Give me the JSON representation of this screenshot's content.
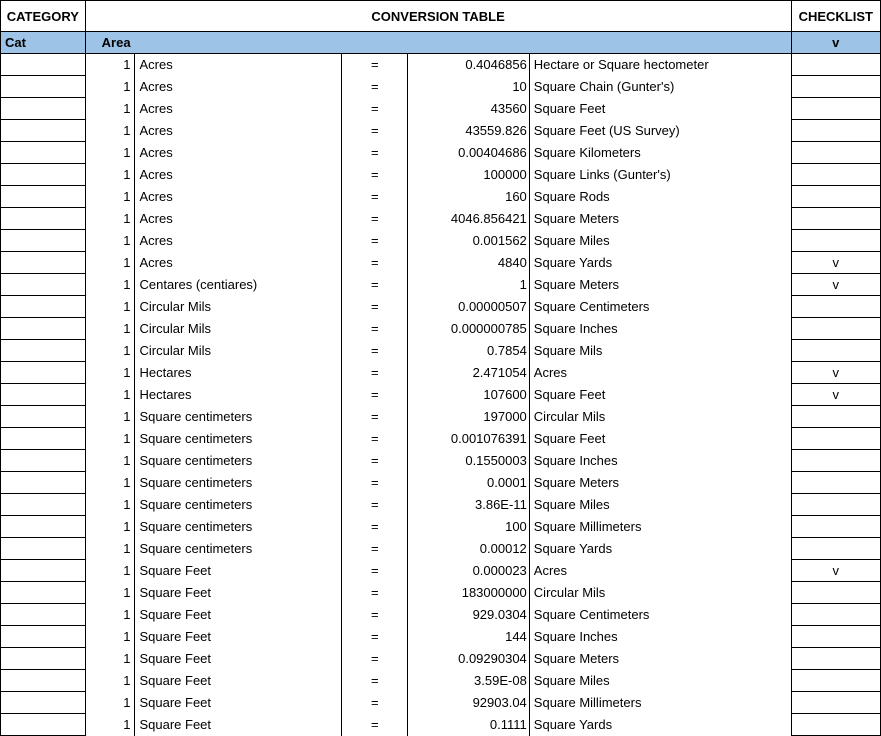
{
  "titles": {
    "category": "CATEGORY",
    "main": "CONVERSION TABLE",
    "checklist": "CHECKLIST"
  },
  "headers": {
    "cat": "Cat",
    "area": "Area",
    "chk": "v"
  },
  "rows": [
    {
      "qty": "1",
      "from": "Acres",
      "eq": "=",
      "val": "0.4046856",
      "to": "Hectare or Square hectometer",
      "chk": ""
    },
    {
      "qty": "1",
      "from": "Acres",
      "eq": "=",
      "val": "10",
      "to": "Square Chain (Gunter's)",
      "chk": ""
    },
    {
      "qty": "1",
      "from": "Acres",
      "eq": "=",
      "val": "43560",
      "to": "Square Feet",
      "chk": ""
    },
    {
      "qty": "1",
      "from": "Acres",
      "eq": "=",
      "val": "43559.826",
      "to": "Square Feet (US Survey)",
      "chk": ""
    },
    {
      "qty": "1",
      "from": "Acres",
      "eq": "=",
      "val": "0.00404686",
      "to": "Square Kilometers",
      "chk": ""
    },
    {
      "qty": "1",
      "from": "Acres",
      "eq": "=",
      "val": "100000",
      "to": "Square Links (Gunter's)",
      "chk": ""
    },
    {
      "qty": "1",
      "from": "Acres",
      "eq": "=",
      "val": "160",
      "to": "Square Rods",
      "chk": ""
    },
    {
      "qty": "1",
      "from": "Acres",
      "eq": "=",
      "val": "4046.856421",
      "to": "Square Meters",
      "chk": ""
    },
    {
      "qty": "1",
      "from": "Acres",
      "eq": "=",
      "val": "0.001562",
      "to": "Square Miles",
      "chk": ""
    },
    {
      "qty": "1",
      "from": "Acres",
      "eq": "=",
      "val": "4840",
      "to": "Square Yards",
      "chk": "v"
    },
    {
      "qty": "1",
      "from": "Centares (centiares)",
      "eq": "=",
      "val": "1",
      "to": "Square Meters",
      "chk": "v"
    },
    {
      "qty": "1",
      "from": "Circular Mils",
      "eq": "=",
      "val": "0.00000507",
      "to": "Square Centimeters",
      "chk": ""
    },
    {
      "qty": "1",
      "from": "Circular Mils",
      "eq": "=",
      "val": "0.000000785",
      "to": "Square Inches",
      "chk": ""
    },
    {
      "qty": "1",
      "from": "Circular Mils",
      "eq": "=",
      "val": "0.7854",
      "to": "Square Mils",
      "chk": ""
    },
    {
      "qty": "1",
      "from": "Hectares",
      "eq": "=",
      "val": "2.471054",
      "to": "Acres",
      "chk": "v"
    },
    {
      "qty": "1",
      "from": "Hectares",
      "eq": "=",
      "val": "107600",
      "to": "Square Feet",
      "chk": "v"
    },
    {
      "qty": "1",
      "from": "Square centimeters",
      "eq": "=",
      "val": "197000",
      "to": "Circular Mils",
      "chk": ""
    },
    {
      "qty": "1",
      "from": "Square centimeters",
      "eq": "=",
      "val": "0.001076391",
      "to": "Square Feet",
      "chk": ""
    },
    {
      "qty": "1",
      "from": "Square centimeters",
      "eq": "=",
      "val": "0.1550003",
      "to": "Square Inches",
      "chk": ""
    },
    {
      "qty": "1",
      "from": "Square centimeters",
      "eq": "=",
      "val": "0.0001",
      "to": "Square Meters",
      "chk": ""
    },
    {
      "qty": "1",
      "from": "Square centimeters",
      "eq": "=",
      "val": "3.86E-11",
      "to": "Square Miles",
      "chk": ""
    },
    {
      "qty": "1",
      "from": "Square centimeters",
      "eq": "=",
      "val": "100",
      "to": "Square Millimeters",
      "chk": ""
    },
    {
      "qty": "1",
      "from": "Square centimeters",
      "eq": "=",
      "val": "0.00012",
      "to": "Square Yards",
      "chk": ""
    },
    {
      "qty": "1",
      "from": "Square Feet",
      "eq": "=",
      "val": "0.000023",
      "to": "Acres",
      "chk": "v"
    },
    {
      "qty": "1",
      "from": "Square Feet",
      "eq": "=",
      "val": "183000000",
      "to": "Circular Mils",
      "chk": ""
    },
    {
      "qty": "1",
      "from": "Square Feet",
      "eq": "=",
      "val": "929.0304",
      "to": "Square Centimeters",
      "chk": ""
    },
    {
      "qty": "1",
      "from": "Square Feet",
      "eq": "=",
      "val": "144",
      "to": "Square Inches",
      "chk": ""
    },
    {
      "qty": "1",
      "from": "Square Feet",
      "eq": "=",
      "val": "0.09290304",
      "to": "Square Meters",
      "chk": ""
    },
    {
      "qty": "1",
      "from": "Square Feet",
      "eq": "=",
      "val": "3.59E-08",
      "to": "Square Miles",
      "chk": ""
    },
    {
      "qty": "1",
      "from": "Square Feet",
      "eq": "=",
      "val": "92903.04",
      "to": "Square Millimeters",
      "chk": ""
    },
    {
      "qty": "1",
      "from": "Square Feet",
      "eq": "=",
      "val": "0.1111",
      "to": "Square Yards",
      "chk": ""
    }
  ]
}
